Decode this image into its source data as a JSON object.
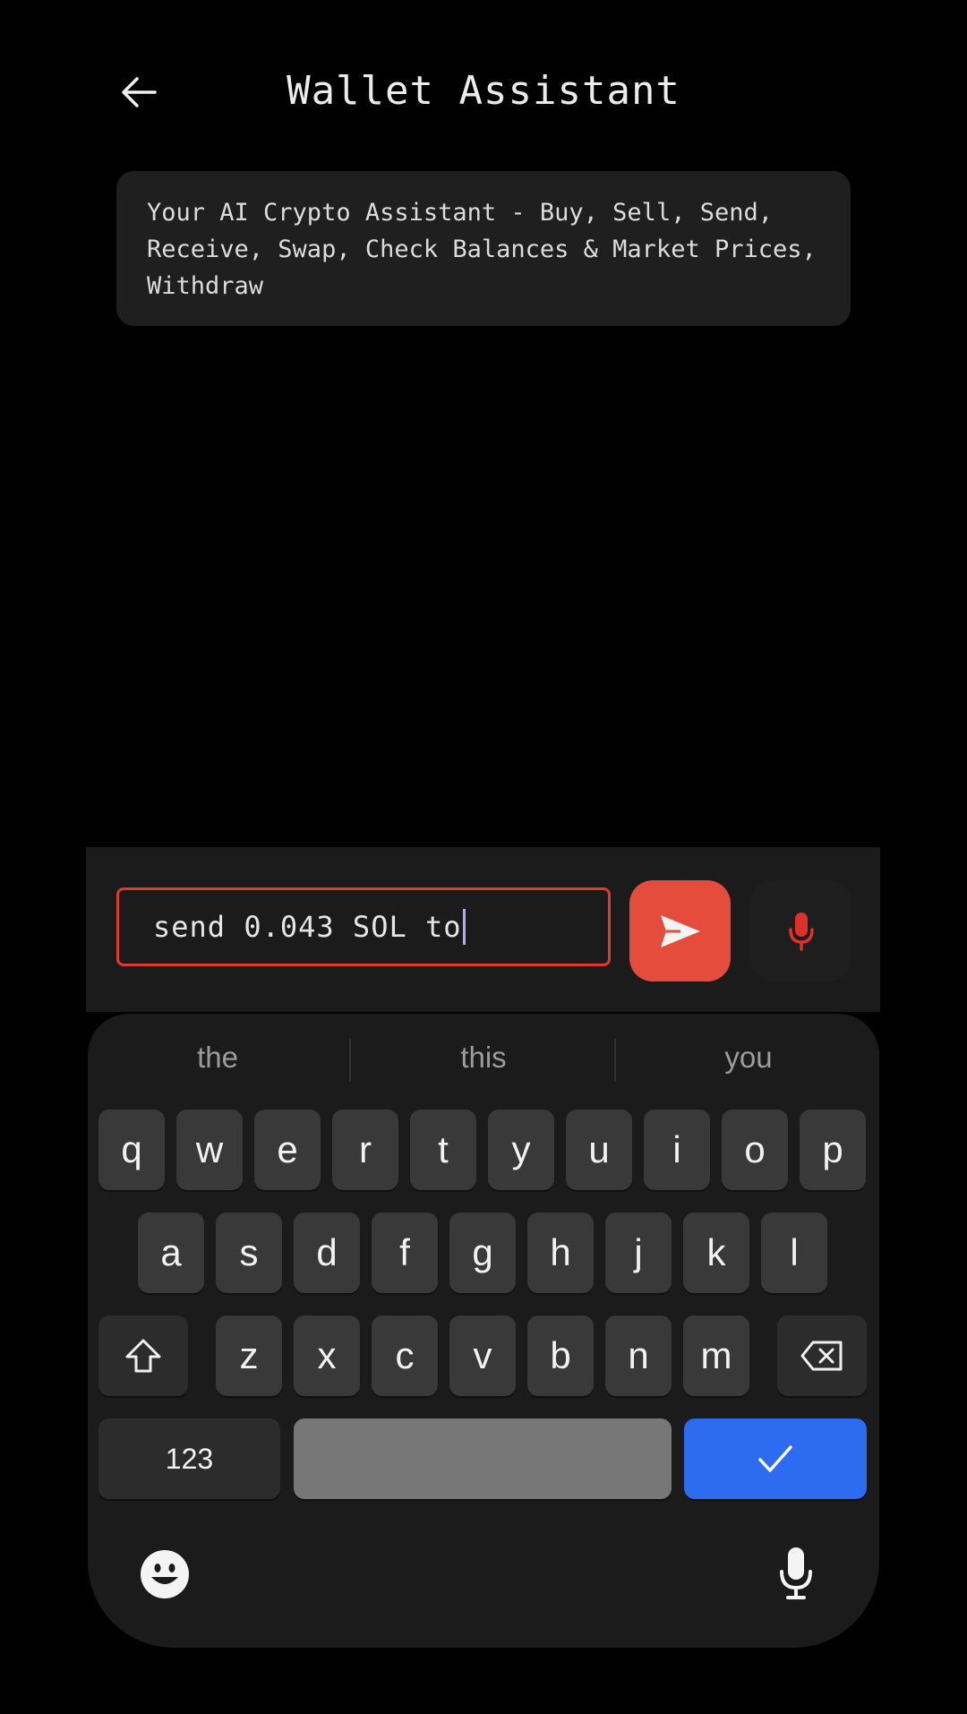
{
  "header": {
    "title": "Wallet Assistant"
  },
  "intro": {
    "text": "Your AI Crypto Assistant - Buy, Sell, Send, Receive, Swap, Check Balances & Market Prices, Withdraw"
  },
  "composer": {
    "input_value": "send 0.043 SOL to",
    "input_border_color": "#e03a2e",
    "send_button_color": "#e54c3c",
    "send_icon": "send-icon",
    "voice_icon": "microphone-icon"
  },
  "keyboard": {
    "suggestions": [
      "the",
      "this",
      "you"
    ],
    "rows": [
      [
        "q",
        "w",
        "e",
        "r",
        "t",
        "y",
        "u",
        "i",
        "o",
        "p"
      ],
      [
        "a",
        "s",
        "d",
        "f",
        "g",
        "h",
        "j",
        "k",
        "l"
      ],
      [
        "z",
        "x",
        "c",
        "v",
        "b",
        "n",
        "m"
      ]
    ],
    "numbers_label": "123",
    "shift_icon": "shift-icon",
    "backspace_icon": "backspace-icon",
    "done_icon": "checkmark-icon",
    "done_color": "#2d6bf0",
    "emoji_icon": "emoji-icon",
    "voice_input_icon": "microphone-icon"
  }
}
